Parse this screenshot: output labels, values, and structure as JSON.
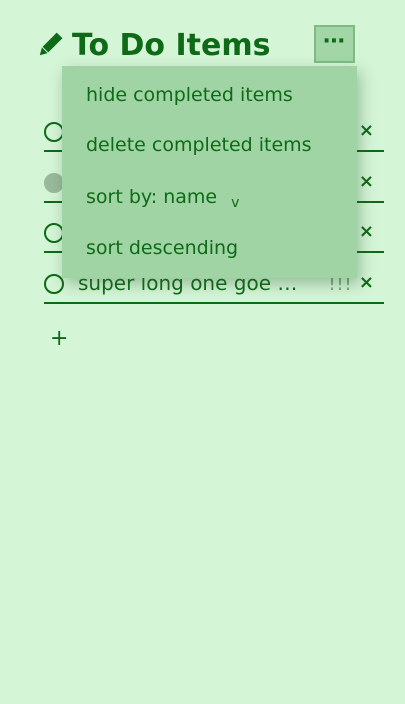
{
  "header": {
    "title": "To Do Items",
    "more_label": "⋯"
  },
  "todos": [
    {
      "text": "",
      "done": false,
      "priority": "",
      "delete_label": "×"
    },
    {
      "text": "",
      "done": true,
      "priority": "",
      "delete_label": "×"
    },
    {
      "text": "",
      "done": false,
      "priority": "",
      "delete_label": "×"
    },
    {
      "text": "super long one goe …",
      "done": false,
      "priority": "!!!",
      "delete_label": "×"
    }
  ],
  "add_label": "+",
  "menu": {
    "items": [
      {
        "label": "hide completed items"
      },
      {
        "label": "delete completed items"
      },
      {
        "label": "sort by: name",
        "caret": "v"
      },
      {
        "label": "sort descending"
      }
    ]
  },
  "colors": {
    "background": "#d4f5d6",
    "accent": "#0e6a17",
    "menu_bg": "#a0d4a4",
    "done_check": "#9ab99c"
  }
}
